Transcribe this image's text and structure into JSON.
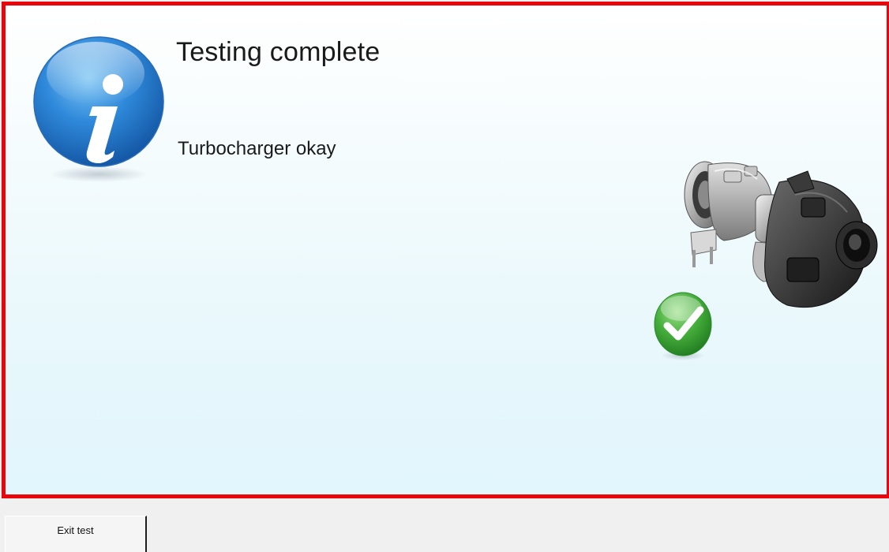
{
  "dialog": {
    "title": "Testing complete",
    "message": "Turbocharger okay"
  },
  "icons": {
    "info": "info-icon",
    "status": "green-check-icon",
    "component": "turbocharger-image"
  },
  "footer": {
    "exit_label": "Exit test"
  },
  "colors": {
    "frame_border": "#e8060c",
    "info_blue": "#1e74c8",
    "check_green": "#3fa83a",
    "background_tint": "#e4f6fc"
  }
}
